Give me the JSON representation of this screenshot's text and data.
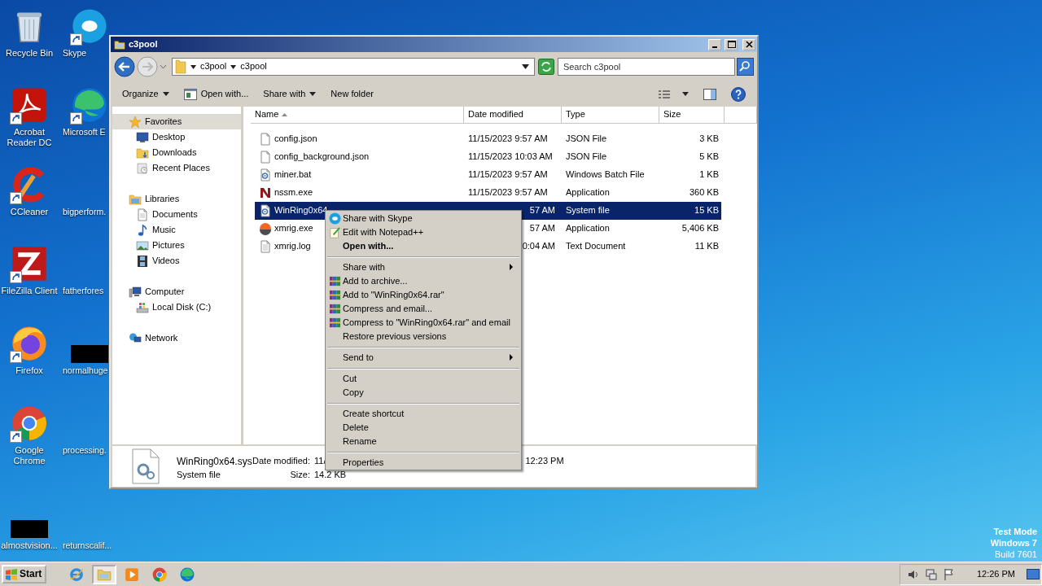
{
  "desktop": {
    "icons": [
      {
        "label": "Recycle Bin",
        "kind": "trash",
        "shortcut": false
      },
      {
        "label": "Skype",
        "kind": "chat",
        "shortcut": true
      },
      {
        "label": "Acrobat Reader DC",
        "kind": "pdf",
        "shortcut": true
      },
      {
        "label": "Microsoft E",
        "kind": "edge",
        "shortcut": true
      },
      {
        "label": "CCleaner",
        "kind": "cleaner",
        "shortcut": true
      },
      {
        "label": "bigperform.",
        "kind": "blank",
        "shortcut": false
      },
      {
        "label": "FileZilla Client",
        "kind": "ftp",
        "shortcut": true
      },
      {
        "label": "fatherfores",
        "kind": "blank",
        "shortcut": false
      },
      {
        "label": "Firefox",
        "kind": "firefox",
        "shortcut": true
      },
      {
        "label": "normalhuge",
        "kind": "thumb",
        "shortcut": false
      },
      {
        "label": "Google Chrome",
        "kind": "chrome",
        "shortcut": true
      },
      {
        "label": "processing.",
        "kind": "blank",
        "shortcut": false
      },
      {
        "label": "almostvision...",
        "kind": "thumb",
        "shortcut": false
      },
      {
        "label": "returnscalif...",
        "kind": "blank",
        "shortcut": false
      }
    ],
    "watermark": [
      "Test Mode",
      "Windows 7",
      "Build 7601"
    ]
  },
  "explorer": {
    "title": "c3pool",
    "breadcrumbs": [
      "c3pool",
      "c3pool"
    ],
    "search": {
      "placeholder": "Search c3pool"
    },
    "toolbar": [
      {
        "label": "Organize",
        "kind": "plain",
        "dropdown": true
      },
      {
        "label": "Open with...",
        "kind": "open-with",
        "dropdown": false
      },
      {
        "label": "Share with",
        "kind": "plain",
        "dropdown": true
      },
      {
        "label": "New folder",
        "kind": "plain",
        "dropdown": false
      }
    ],
    "nav": [
      {
        "label": "Favorites",
        "kind": "star",
        "selected": true,
        "children": [
          {
            "label": "Desktop",
            "kind": "desktop",
            "selected": false
          },
          {
            "label": "Downloads",
            "kind": "downloads",
            "selected": false
          },
          {
            "label": "Recent Places",
            "kind": "recent",
            "selected": false
          }
        ]
      },
      {
        "label": "Libraries",
        "kind": "libraries",
        "selected": false,
        "children": [
          {
            "label": "Documents",
            "kind": "documents",
            "selected": false
          },
          {
            "label": "Music",
            "kind": "music",
            "selected": false
          },
          {
            "label": "Pictures",
            "kind": "pictures",
            "selected": false
          },
          {
            "label": "Videos",
            "kind": "videos",
            "selected": false
          }
        ]
      },
      {
        "label": "Computer",
        "kind": "computer",
        "selected": false,
        "children": [
          {
            "label": "Local Disk (C:)",
            "kind": "disk",
            "selected": false
          }
        ]
      },
      {
        "label": "Network",
        "kind": "network",
        "selected": false
      }
    ],
    "columns": [
      {
        "label": "Name",
        "sorted": true
      },
      {
        "label": "Date modified",
        "sorted": false
      },
      {
        "label": "Type",
        "sorted": false
      },
      {
        "label": "Size",
        "sorted": false
      }
    ],
    "files": [
      {
        "name": "config.json",
        "kind": "document",
        "date": "11/15/2023 9:57 AM",
        "date_partial": false,
        "type": "JSON File",
        "size": "3 KB",
        "selected": false
      },
      {
        "name": "config_background.json",
        "kind": "document",
        "date": "11/15/2023 10:03 AM",
        "date_partial": false,
        "type": "JSON File",
        "size": "5 KB",
        "selected": false
      },
      {
        "name": "miner.bat",
        "kind": "gear-page",
        "date": "11/15/2023 9:57 AM",
        "date_partial": false,
        "type": "Windows Batch File",
        "size": "1 KB",
        "selected": false
      },
      {
        "name": "nssm.exe",
        "kind": "service",
        "date": "11/15/2023 9:57 AM",
        "date_partial": false,
        "type": "Application",
        "size": "360 KB",
        "selected": false
      },
      {
        "name": "WinRing0x64",
        "kind": "gear-page",
        "date": "57 AM",
        "date_partial": true,
        "type": "System file",
        "size": "15 KB",
        "selected": true
      },
      {
        "name": "xmrig.exe",
        "kind": "coin",
        "date": "57 AM",
        "date_partial": true,
        "type": "Application",
        "size": "5,406 KB",
        "selected": false
      },
      {
        "name": "xmrig.log",
        "kind": "text",
        "date": "0:04 AM",
        "date_partial": true,
        "type": "Text Document",
        "size": "11 KB",
        "selected": false
      }
    ],
    "details": {
      "name": "WinRing0x64.sys",
      "type": "System file",
      "date_label": "Date modified:",
      "date_start": "11/",
      "date_end": "12:23 PM",
      "size_label": "Size:",
      "size": "14.2 KB"
    }
  },
  "context_menu": {
    "groups": [
      [
        {
          "label": "Share with Skype",
          "kind": "chat",
          "default": false,
          "submenu": false
        },
        {
          "label": "Edit with Notepad++",
          "kind": "notepad",
          "default": false,
          "submenu": false
        },
        {
          "label": "Open with...",
          "kind": "plain",
          "default": true,
          "submenu": false
        }
      ],
      [
        {
          "label": "Share with",
          "kind": "plain",
          "default": false,
          "submenu": true
        },
        {
          "label": "Add to archive...",
          "kind": "archive",
          "default": false,
          "submenu": false
        },
        {
          "label": "Add to \"WinRing0x64.rar\"",
          "kind": "archive",
          "default": false,
          "submenu": false
        },
        {
          "label": "Compress and email...",
          "kind": "archive",
          "default": false,
          "submenu": false
        },
        {
          "label": "Compress to \"WinRing0x64.rar\" and email",
          "kind": "archive",
          "default": false,
          "submenu": false
        },
        {
          "label": "Restore previous versions",
          "kind": "plain",
          "default": false,
          "submenu": false
        }
      ],
      [
        {
          "label": "Send to",
          "kind": "plain",
          "default": false,
          "submenu": true
        }
      ],
      [
        {
          "label": "Cut",
          "kind": "plain",
          "default": false,
          "submenu": false
        },
        {
          "label": "Copy",
          "kind": "plain",
          "default": false,
          "submenu": false
        }
      ],
      [
        {
          "label": "Create shortcut",
          "kind": "plain",
          "default": false,
          "submenu": false
        },
        {
          "label": "Delete",
          "kind": "plain",
          "default": false,
          "submenu": false
        },
        {
          "label": "Rename",
          "kind": "plain",
          "default": false,
          "submenu": false
        }
      ],
      [
        {
          "label": "Properties",
          "kind": "plain",
          "default": false,
          "submenu": false
        }
      ]
    ]
  },
  "taskbar": {
    "start": "Start",
    "apps": [
      {
        "kind": "ie",
        "active": false
      },
      {
        "kind": "folder",
        "active": true
      },
      {
        "kind": "media",
        "active": false
      },
      {
        "kind": "chrome",
        "active": false
      },
      {
        "kind": "edge",
        "active": false
      }
    ],
    "clock": "12:26 PM"
  }
}
